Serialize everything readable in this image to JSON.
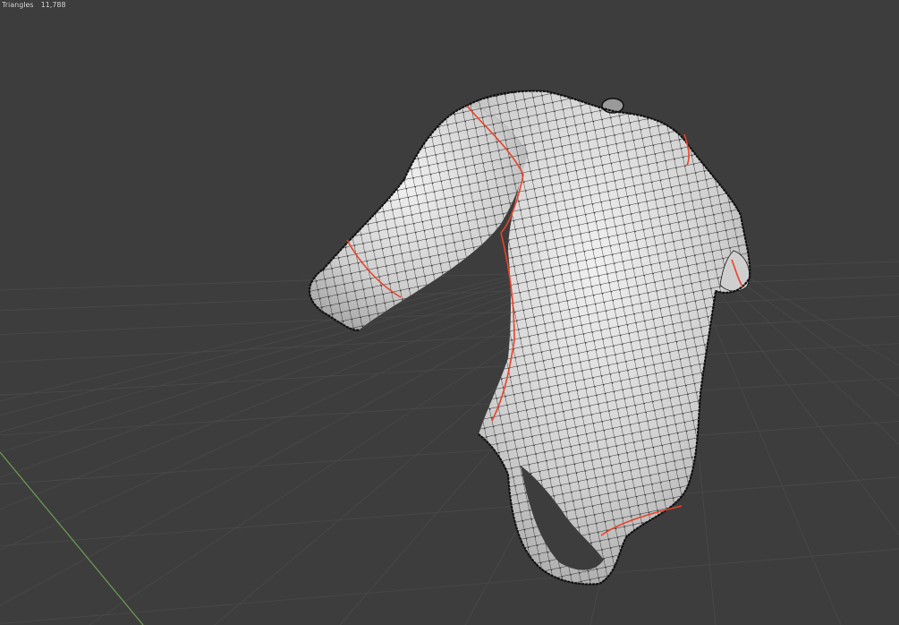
{
  "viewport": {
    "background": "#3d3d3d",
    "grid_color": "#4a4a4a",
    "axis_y_color": "#6e9e55",
    "mesh_face_color": "#d4d4d4",
    "mesh_edge_color": "#111111",
    "seam_color": "#e8432a",
    "mode": "edit-mode-wireframe-overlay"
  },
  "stats": {
    "label": "Triangles",
    "value": "11,788"
  },
  "object": {
    "icon": "mesh-shirt-bodysuit-icon"
  }
}
